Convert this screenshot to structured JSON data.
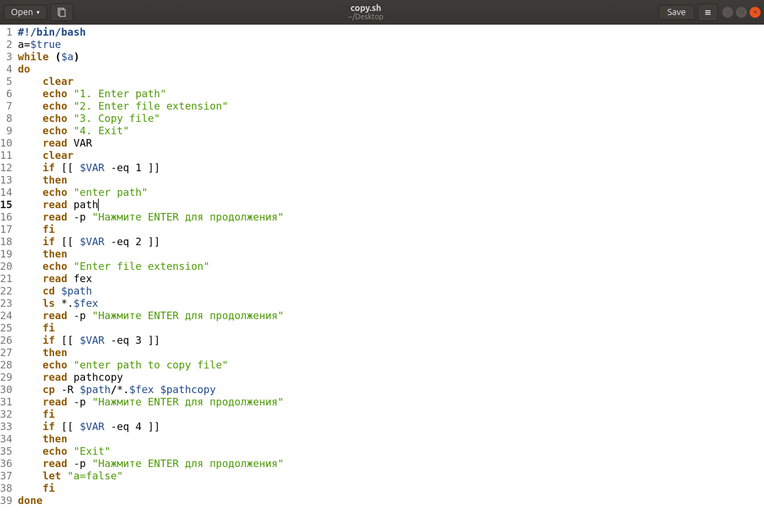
{
  "header": {
    "open_label": "Open",
    "save_label": "Save",
    "filename": "copy.sh",
    "filepath": "~/Desktop"
  },
  "current_line": 15,
  "lines": [
    {
      "n": 1,
      "ind": 0,
      "tokens": [
        {
          "t": "#!/bin/bash",
          "c": "shebang"
        }
      ]
    },
    {
      "n": 2,
      "ind": 0,
      "tokens": [
        {
          "t": "a",
          "c": "ident2"
        },
        {
          "t": "=",
          "c": "assign"
        },
        {
          "t": "$true",
          "c": "var"
        }
      ]
    },
    {
      "n": 3,
      "ind": 0,
      "tokens": [
        {
          "t": "while ",
          "c": "keyword"
        },
        {
          "t": "(",
          "c": "bracket"
        },
        {
          "t": "$a",
          "c": "var"
        },
        {
          "t": ")",
          "c": "bracket"
        }
      ]
    },
    {
      "n": 4,
      "ind": 0,
      "tokens": [
        {
          "t": "do",
          "c": "keyword"
        }
      ]
    },
    {
      "n": 5,
      "ind": 1,
      "tokens": [
        {
          "t": "clear",
          "c": "keyword"
        }
      ]
    },
    {
      "n": 6,
      "ind": 1,
      "tokens": [
        {
          "t": "echo ",
          "c": "keyword"
        },
        {
          "t": "\"1. Enter path\"",
          "c": "string"
        }
      ]
    },
    {
      "n": 7,
      "ind": 1,
      "tokens": [
        {
          "t": "echo ",
          "c": "keyword"
        },
        {
          "t": "\"2. Enter file extension\"",
          "c": "string"
        }
      ]
    },
    {
      "n": 8,
      "ind": 1,
      "tokens": [
        {
          "t": "echo ",
          "c": "keyword"
        },
        {
          "t": "\"3. Copy file\"",
          "c": "string"
        }
      ]
    },
    {
      "n": 9,
      "ind": 1,
      "tokens": [
        {
          "t": "echo ",
          "c": "keyword"
        },
        {
          "t": "\"4. Exit\"",
          "c": "string"
        }
      ]
    },
    {
      "n": 10,
      "ind": 1,
      "tokens": [
        {
          "t": "read ",
          "c": "keyword"
        },
        {
          "t": "VAR",
          "c": "plain"
        }
      ]
    },
    {
      "n": 11,
      "ind": 1,
      "tokens": [
        {
          "t": "clear",
          "c": "keyword"
        }
      ]
    },
    {
      "n": 12,
      "ind": 1,
      "tokens": [
        {
          "t": "if ",
          "c": "keyword"
        },
        {
          "t": "[[ ",
          "c": "plain"
        },
        {
          "t": "$VAR",
          "c": "var"
        },
        {
          "t": " -eq 1 ]]",
          "c": "plain"
        }
      ]
    },
    {
      "n": 13,
      "ind": 1,
      "tokens": [
        {
          "t": "then",
          "c": "keyword"
        }
      ]
    },
    {
      "n": 14,
      "ind": 1,
      "tokens": [
        {
          "t": "echo ",
          "c": "keyword"
        },
        {
          "t": "\"enter path\"",
          "c": "string"
        }
      ]
    },
    {
      "n": 15,
      "ind": 1,
      "tokens": [
        {
          "t": "read ",
          "c": "keyword"
        },
        {
          "t": "path",
          "c": "plain"
        }
      ]
    },
    {
      "n": 16,
      "ind": 1,
      "tokens": [
        {
          "t": "read ",
          "c": "keyword"
        },
        {
          "t": "-p ",
          "c": "plain"
        },
        {
          "t": "\"Нажмите ENTER для продолжения\"",
          "c": "string"
        }
      ]
    },
    {
      "n": 17,
      "ind": 1,
      "tokens": [
        {
          "t": "fi",
          "c": "keyword"
        }
      ]
    },
    {
      "n": 18,
      "ind": 1,
      "tokens": [
        {
          "t": "if ",
          "c": "keyword"
        },
        {
          "t": "[[ ",
          "c": "plain"
        },
        {
          "t": "$VAR",
          "c": "var"
        },
        {
          "t": " -eq 2 ]]",
          "c": "plain"
        }
      ]
    },
    {
      "n": 19,
      "ind": 1,
      "tokens": [
        {
          "t": "then",
          "c": "keyword"
        }
      ]
    },
    {
      "n": 20,
      "ind": 1,
      "tokens": [
        {
          "t": "echo ",
          "c": "keyword"
        },
        {
          "t": "\"Enter file extension\"",
          "c": "string"
        }
      ]
    },
    {
      "n": 21,
      "ind": 1,
      "tokens": [
        {
          "t": "read ",
          "c": "keyword"
        },
        {
          "t": "fex",
          "c": "plain"
        }
      ]
    },
    {
      "n": 22,
      "ind": 1,
      "tokens": [
        {
          "t": "cd ",
          "c": "keyword"
        },
        {
          "t": "$path",
          "c": "var"
        }
      ]
    },
    {
      "n": 23,
      "ind": 1,
      "tokens": [
        {
          "t": "ls ",
          "c": "keyword"
        },
        {
          "t": "*.",
          "c": "plain"
        },
        {
          "t": "$fex",
          "c": "var"
        }
      ]
    },
    {
      "n": 24,
      "ind": 1,
      "tokens": [
        {
          "t": "read ",
          "c": "keyword"
        },
        {
          "t": "-p ",
          "c": "plain"
        },
        {
          "t": "\"Нажмите ENTER для продолжения\"",
          "c": "string"
        }
      ]
    },
    {
      "n": 25,
      "ind": 1,
      "tokens": [
        {
          "t": "fi",
          "c": "keyword"
        }
      ]
    },
    {
      "n": 26,
      "ind": 1,
      "tokens": [
        {
          "t": "if ",
          "c": "keyword"
        },
        {
          "t": "[[ ",
          "c": "plain"
        },
        {
          "t": "$VAR",
          "c": "var"
        },
        {
          "t": " -eq 3 ]]",
          "c": "plain"
        }
      ]
    },
    {
      "n": 27,
      "ind": 1,
      "tokens": [
        {
          "t": "then",
          "c": "keyword"
        }
      ]
    },
    {
      "n": 28,
      "ind": 1,
      "tokens": [
        {
          "t": "echo ",
          "c": "keyword"
        },
        {
          "t": "\"enter path to copy file\"",
          "c": "string"
        }
      ]
    },
    {
      "n": 29,
      "ind": 1,
      "tokens": [
        {
          "t": "read ",
          "c": "keyword"
        },
        {
          "t": "pathcopy",
          "c": "plain"
        }
      ]
    },
    {
      "n": 30,
      "ind": 1,
      "tokens": [
        {
          "t": "cp ",
          "c": "keyword"
        },
        {
          "t": "-R ",
          "c": "plain"
        },
        {
          "t": "$path",
          "c": "var"
        },
        {
          "t": "/",
          "c": "bracket"
        },
        {
          "t": "*.",
          "c": "plain"
        },
        {
          "t": "$fex",
          "c": "var"
        },
        {
          "t": " ",
          "c": "plain"
        },
        {
          "t": "$pathcopy",
          "c": "var"
        }
      ]
    },
    {
      "n": 31,
      "ind": 1,
      "tokens": [
        {
          "t": "read ",
          "c": "keyword"
        },
        {
          "t": "-p ",
          "c": "plain"
        },
        {
          "t": "\"Нажмите ENTER для продолжения\"",
          "c": "string"
        }
      ]
    },
    {
      "n": 32,
      "ind": 1,
      "tokens": [
        {
          "t": "fi",
          "c": "keyword"
        }
      ]
    },
    {
      "n": 33,
      "ind": 1,
      "tokens": [
        {
          "t": "if ",
          "c": "keyword"
        },
        {
          "t": "[[ ",
          "c": "plain"
        },
        {
          "t": "$VAR",
          "c": "var"
        },
        {
          "t": " -eq 4 ]]",
          "c": "plain"
        }
      ]
    },
    {
      "n": 34,
      "ind": 1,
      "tokens": [
        {
          "t": "then",
          "c": "keyword"
        }
      ]
    },
    {
      "n": 35,
      "ind": 1,
      "tokens": [
        {
          "t": "echo ",
          "c": "keyword"
        },
        {
          "t": "\"Exit\"",
          "c": "string"
        }
      ]
    },
    {
      "n": 36,
      "ind": 1,
      "tokens": [
        {
          "t": "read ",
          "c": "keyword"
        },
        {
          "t": "-p ",
          "c": "plain"
        },
        {
          "t": "\"Нажмите ENTER для продолжения\"",
          "c": "string"
        }
      ]
    },
    {
      "n": 37,
      "ind": 1,
      "tokens": [
        {
          "t": "let ",
          "c": "keyword"
        },
        {
          "t": "\"a=false\"",
          "c": "string"
        }
      ]
    },
    {
      "n": 38,
      "ind": 1,
      "tokens": [
        {
          "t": "fi",
          "c": "keyword"
        }
      ]
    },
    {
      "n": 39,
      "ind": 0,
      "tokens": [
        {
          "t": "done",
          "c": "keyword"
        }
      ]
    }
  ]
}
